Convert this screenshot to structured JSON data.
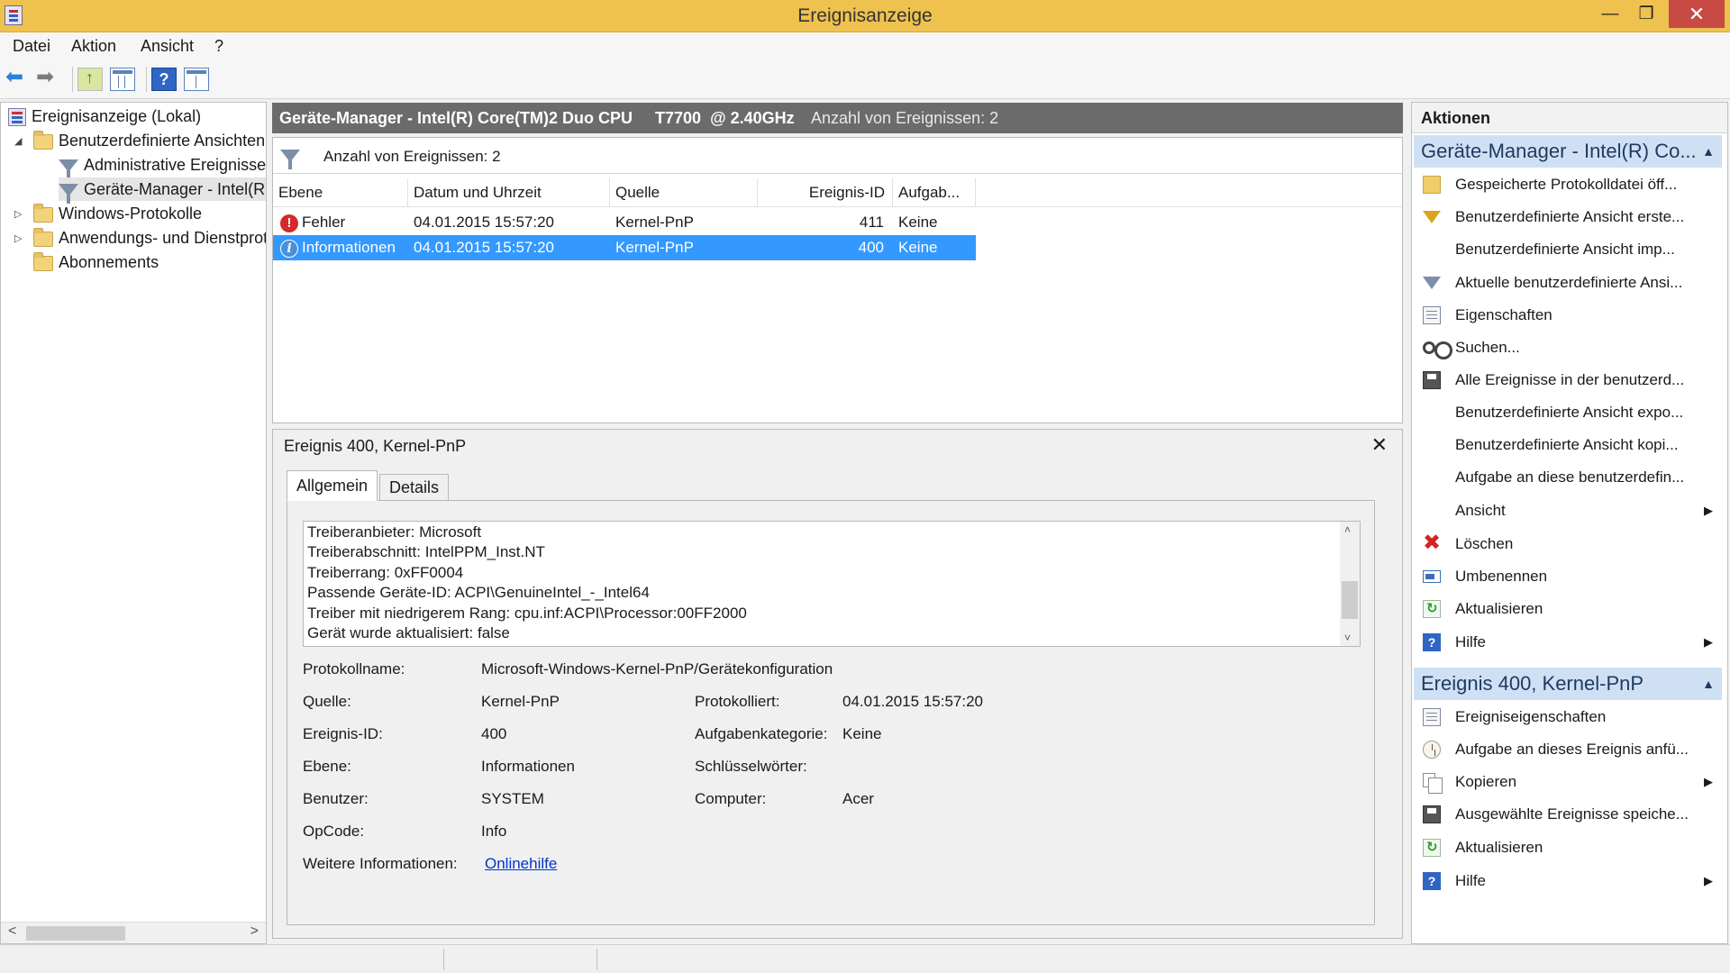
{
  "window": {
    "title": "Ereignisanzeige",
    "minimize": "—",
    "maximize": "❐",
    "close": "✕"
  },
  "menu": [
    "Datei",
    "Aktion",
    "Ansicht",
    "?"
  ],
  "toolbar": {
    "icons": [
      "back-arrow-icon",
      "forward-arrow-icon",
      "up-folder-icon",
      "console-tree-icon",
      "help-icon",
      "action-pane-icon"
    ],
    "help_label": "?"
  },
  "tree": {
    "root": "Ereignisanzeige (Lokal)",
    "custom_views": "Benutzerdefinierte Ansichten",
    "admin_events": "Administrative Ereignisse",
    "device_manager": "Geräte-Manager - Intel(R",
    "windows_logs": "Windows-Protokolle",
    "app_services": "Anwendungs- und Dienstprotokolle",
    "subscriptions": "Abonnements",
    "expanded": "◢",
    "collapsed": "▷",
    "scroll_left": "<",
    "scroll_right": ">"
  },
  "center": {
    "header_title": "Geräte-Manager - Intel(R) Core(TM)2 Duo CPU     T7700  @ 2.40GHz",
    "header_count": "Anzahl von Ereignissen: 2",
    "filter_count": "Anzahl von Ereignissen: 2",
    "columns": [
      "Ebene",
      "Datum und Uhrzeit",
      "Quelle",
      "Ereignis-ID",
      "Aufgab..."
    ],
    "rows": [
      {
        "level": "Fehler",
        "level_glyph": "!",
        "datetime": "04.01.2015 15:57:20",
        "source": "Kernel-PnP",
        "id": "411",
        "task": "Keine"
      },
      {
        "level": "Informationen",
        "level_glyph": "i",
        "datetime": "04.01.2015 15:57:20",
        "source": "Kernel-PnP",
        "id": "400",
        "task": "Keine"
      }
    ]
  },
  "detail": {
    "title": "Ereignis 400, Kernel-PnP",
    "close": "✕",
    "tabs": [
      "Allgemein",
      "Details"
    ],
    "text_lines": [
      "Treiberanbieter: Microsoft",
      "Treiberabschnitt: IntelPPM_Inst.NT",
      "Treiberrang: 0xFF0004",
      "Passende Geräte-ID: ACPI\\GenuineIntel_-_Intel64",
      "Treiber mit niedrigerem Rang: cpu.inf:ACPI\\Processor:00FF2000",
      "Gerät wurde aktualisiert: false"
    ],
    "scroll_up": "˄",
    "scroll_down": "˅",
    "labels": {
      "log_name": "Protokollname:",
      "source": "Quelle:",
      "event_id": "Ereignis-ID:",
      "level": "Ebene:",
      "user": "Benutzer:",
      "opcode": "OpCode:",
      "more_info": "Weitere Informationen:",
      "logged": "Protokolliert:",
      "task_category": "Aufgabenkategorie:",
      "keywords": "Schlüsselwörter:",
      "computer": "Computer:"
    },
    "values": {
      "log_name": "Microsoft-Windows-Kernel-PnP/Gerätekonfiguration",
      "source": "Kernel-PnP",
      "event_id": "400",
      "level": "Informationen",
      "user": "SYSTEM",
      "opcode": "Info",
      "more_info_link": "Onlinehilfe",
      "logged": "04.01.2015 15:57:20",
      "task_category": "Keine",
      "keywords": "",
      "computer": "Acer"
    }
  },
  "actions": {
    "header": "Aktionen",
    "section1": "Geräte-Manager - Intel(R) Co...",
    "section1_items": [
      {
        "label": "Gespeicherte Protokolldatei öff...",
        "icon": "open-log-icon"
      },
      {
        "label": "Benutzerdefinierte Ansicht erste...",
        "icon": "create-view-icon"
      },
      {
        "label": "Benutzerdefinierte Ansicht imp...",
        "icon": ""
      },
      {
        "label": "Aktuelle benutzerdefinierte Ansi...",
        "icon": "filter-icon"
      },
      {
        "label": "Eigenschaften",
        "icon": "properties-icon"
      },
      {
        "label": "Suchen...",
        "icon": "binoculars-icon"
      },
      {
        "label": "Alle Ereignisse in der benutzerd...",
        "icon": "save-icon"
      },
      {
        "label": "Benutzerdefinierte Ansicht expo...",
        "icon": ""
      },
      {
        "label": "Benutzerdefinierte Ansicht kopi...",
        "icon": ""
      },
      {
        "label": "Aufgabe an diese benutzerdefin...",
        "icon": ""
      },
      {
        "label": "Ansicht",
        "icon": "",
        "submenu": true
      },
      {
        "label": "Löschen",
        "icon": "delete-icon"
      },
      {
        "label": "Umbenennen",
        "icon": "rename-icon"
      },
      {
        "label": "Aktualisieren",
        "icon": "refresh-icon"
      },
      {
        "label": "Hilfe",
        "icon": "help-icon",
        "submenu": true
      }
    ],
    "section2": "Ereignis 400, Kernel-PnP",
    "section2_items": [
      {
        "label": "Ereigniseigenschaften",
        "icon": "properties-icon"
      },
      {
        "label": "Aufgabe an dieses Ereignis anfü...",
        "icon": "task-icon"
      },
      {
        "label": "Kopieren",
        "icon": "copy-icon",
        "submenu": true
      },
      {
        "label": "Ausgewählte Ereignisse speiche...",
        "icon": "save-icon"
      },
      {
        "label": "Aktualisieren",
        "icon": "refresh-icon"
      },
      {
        "label": "Hilfe",
        "icon": "help-icon",
        "submenu": true
      }
    ],
    "collapse": "▲",
    "submenu_arrow": "▶",
    "help_glyph": "?",
    "delete_glyph": "✖"
  }
}
